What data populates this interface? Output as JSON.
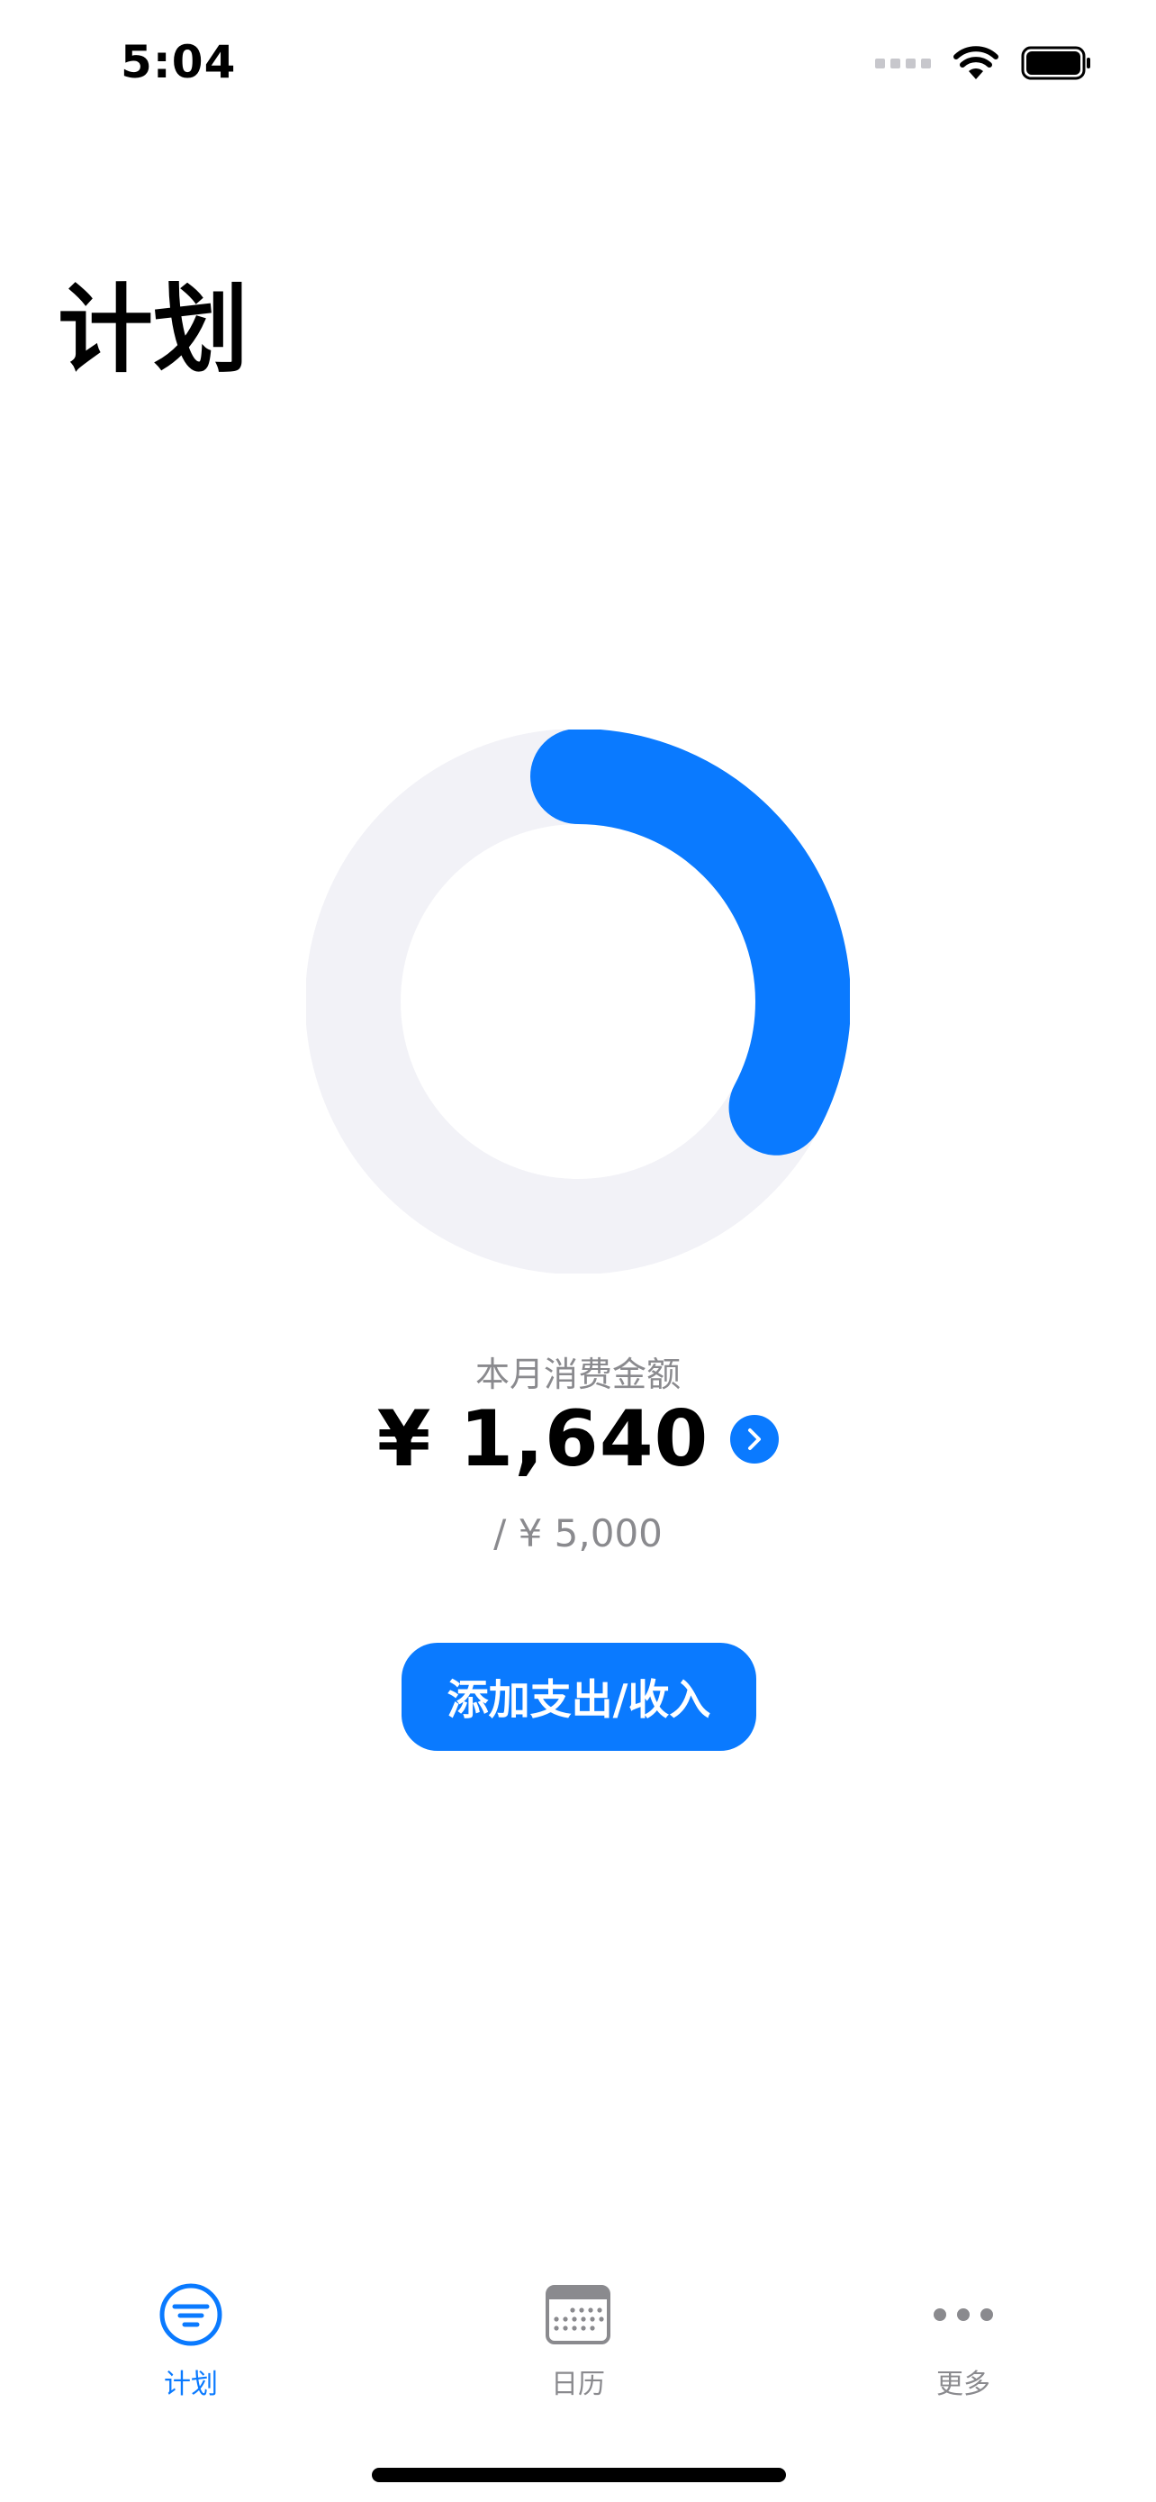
{
  "status_bar": {
    "time": "5:04"
  },
  "title": "计划",
  "summary": {
    "label": "本月消费金额",
    "amount": "¥ 1,640",
    "budget": "/ ¥ 5,000",
    "progress": 0.328
  },
  "add_button_label": "添加支出/收入",
  "tabs": [
    {
      "label": "计划",
      "icon": "plan-list-icon",
      "selected": true
    },
    {
      "label": "日历",
      "icon": "calendar-icon",
      "selected": false
    },
    {
      "label": "更多",
      "icon": "more-ellipsis-icon",
      "selected": false
    }
  ],
  "colors": {
    "accent": "#0a7aff",
    "ring_track": "#f2f2f7",
    "secondary_text": "#8a8a8e"
  }
}
